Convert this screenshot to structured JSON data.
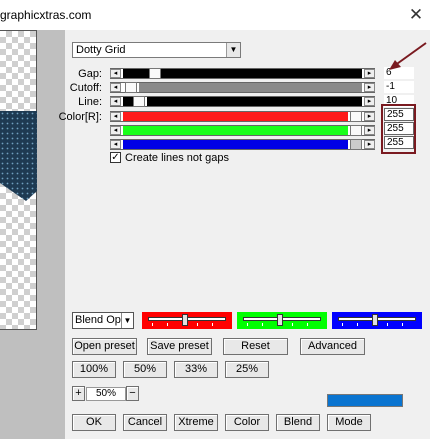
{
  "window": {
    "title": "graphicxtras.com",
    "close_glyph": "✕"
  },
  "filter_select": {
    "value": "Dotty Grid",
    "arrow": "▼"
  },
  "sliders": [
    {
      "label": "Gap:",
      "value": "6"
    },
    {
      "label": "Cutoff:",
      "value": "-1"
    },
    {
      "label": "Line:",
      "value": "10"
    },
    {
      "label": "Color[R]:",
      "value": "255",
      "color": "#ff0000"
    },
    {
      "label": "",
      "value": "255",
      "color": "#00ff00"
    },
    {
      "label": "",
      "value": "255",
      "color": "#0000ff"
    }
  ],
  "slider_arrows": {
    "left": "◂",
    "right": "▸"
  },
  "create_lines": {
    "label": "Create lines not gaps",
    "checked": true,
    "mark": "✓"
  },
  "blend": {
    "value": "Blend Optio",
    "arrow": "▼"
  },
  "color_sliders": [
    {
      "color": "#ff0000"
    },
    {
      "color": "#00ff00"
    },
    {
      "color": "#0000ff"
    }
  ],
  "buttons": {
    "open_preset": "Open preset",
    "save_preset": "Save preset",
    "reset": "Reset",
    "advanced": "Advanced",
    "zoom_100": "100%",
    "zoom_50": "50%",
    "zoom_33": "33%",
    "zoom_25": "25%",
    "zoom_in": "+",
    "zoom_out": "−",
    "ok": "OK",
    "cancel": "Cancel",
    "xtreme": "Xtreme",
    "color": "Color",
    "blend": "Blend",
    "mode": "Mode"
  },
  "zoom_value": "50%",
  "color_swatch": "#0a74d0",
  "annotation_color": "#7a1a20"
}
